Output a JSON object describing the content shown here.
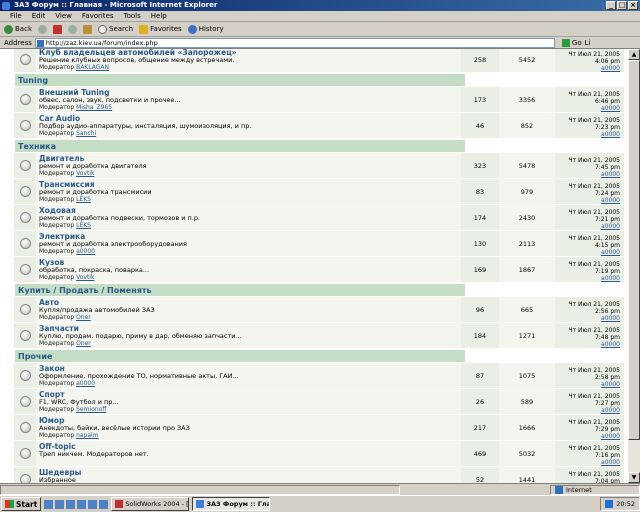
{
  "window": {
    "title": "ЗАЗ Форум :: Главная - Microsoft Internet Explorer"
  },
  "menu": [
    "File",
    "Edit",
    "View",
    "Favorites",
    "Tools",
    "Help"
  ],
  "toolbar": {
    "back": "Back",
    "search": "Search",
    "favorites": "Favorites",
    "history": "History"
  },
  "address": {
    "label": "Address",
    "url": "http://zaz.kiev.ua/forum/index.php",
    "go": "Go",
    "links": "Li"
  },
  "forum": {
    "top_row": {
      "name": "Клуб владельцев автомобилей «Запорожец»",
      "desc": "Решение клубных вопросов, общение между встречами.",
      "mod_label": "Модератор",
      "mod": "BAKLAGAN",
      "topics": "258",
      "posts": "5452",
      "last_date": "Чт Июл 21, 2005 4:06 pm",
      "last_user": "a0000"
    },
    "categories": [
      {
        "title": "Tuning",
        "forums": [
          {
            "name": "Внешний Tuning",
            "desc": "обвес, салон, звук, подсветки и прочее...",
            "mod_label": "Модератор",
            "mod": "Misha_Z965",
            "topics": "173",
            "posts": "3356",
            "last_date": "Чт Июл 21, 2005 6:46 pm",
            "last_user": "a0000"
          },
          {
            "name": "Car Audio",
            "desc": "Подбор аудио-аппаратуры, инсталяция, шумоизоляция, и пр.",
            "mod_label": "Модератор",
            "mod": "Sanchi",
            "topics": "46",
            "posts": "852",
            "last_date": "Чт Июл 21, 2005 7:23 pm",
            "last_user": "a0000"
          }
        ]
      },
      {
        "title": "Техника",
        "forums": [
          {
            "name": "Двигатель",
            "desc": "ремонт и доработка двигателя",
            "mod_label": "Модератор",
            "mod": "Vovtik",
            "topics": "323",
            "posts": "5478",
            "last_date": "Чт Июл 21, 2005 7:45 pm",
            "last_user": "a0000"
          },
          {
            "name": "Трансмиссия",
            "desc": "ремонт и доработка трансмисии",
            "mod_label": "Модератор",
            "mod": "LEKS",
            "topics": "83",
            "posts": "979",
            "last_date": "Чт Июл 21, 2005 7:24 pm",
            "last_user": "a0000"
          },
          {
            "name": "Ходовая",
            "desc": "ремонт и доработка подвески, тормозов и п.р.",
            "mod_label": "Модератор",
            "mod": "LEKS",
            "topics": "174",
            "posts": "2430",
            "last_date": "Чт Июл 21, 2005 7:21 pm",
            "last_user": "a0000"
          },
          {
            "name": "Электрика",
            "desc": "ремонт и доработка электрооборудования",
            "mod_label": "Модератор",
            "mod": "a0000",
            "topics": "130",
            "posts": "2113",
            "last_date": "Чт Июл 21, 2005 4:15 pm",
            "last_user": "a0000"
          },
          {
            "name": "Кузов",
            "desc": "обработка, покраска, поварка...",
            "mod_label": "Модератор",
            "mod": "Vovtik",
            "topics": "169",
            "posts": "1867",
            "last_date": "Чт Июл 21, 2005 7:19 pm",
            "last_user": "a0000"
          }
        ]
      },
      {
        "title": "Купить / Продать / Поменять",
        "forums": [
          {
            "name": "Авто",
            "desc": "Купля/продажа автомобилей ЗАЗ",
            "mod_label": "Модератор",
            "mod": "Oner",
            "topics": "96",
            "posts": "665",
            "last_date": "Чт Июл 21, 2005 2:56 pm",
            "last_user": "a0000"
          },
          {
            "name": "Запчасти",
            "desc": "Куплю, продам, подарю, приму в дар, обменяю запчасти...",
            "mod_label": "Модератор",
            "mod": "Oner",
            "topics": "184",
            "posts": "1271",
            "last_date": "Чт Июл 21, 2005 7:48 pm",
            "last_user": "a0000"
          }
        ]
      },
      {
        "title": "Прочие",
        "forums": [
          {
            "name": "Закон",
            "desc": "Оформление, прохождение ТО, нормативные акты, ГАИ...",
            "mod_label": "Модератор",
            "mod": "a0000",
            "topics": "87",
            "posts": "1075",
            "last_date": "Чт Июл 21, 2005 2:58 pm",
            "last_user": "a0000"
          },
          {
            "name": "Спорт",
            "desc": "F1, WRC, Футбол и пр...",
            "mod_label": "Модератор",
            "mod": "Semionoff",
            "topics": "26",
            "posts": "589",
            "last_date": "Чт Июл 21, 2005 7:27 pm",
            "last_user": "a0000"
          },
          {
            "name": "Юмор",
            "desc": "Анекдоты, байки, весёлые истории про ЗАЗ",
            "mod_label": "Модератор",
            "mod": "napalm",
            "topics": "217",
            "posts": "1666",
            "last_date": "Чт Июл 21, 2005 7:29 pm",
            "last_user": "a0000"
          },
          {
            "name": "Off-topic",
            "desc": "Треп никчем. Модераторов нет.",
            "mod_label": "",
            "mod": "",
            "topics": "469",
            "posts": "5032",
            "last_date": "Чт Июл 21, 2005 7:16 pm",
            "last_user": "a0000"
          },
          {
            "name": "Шедевры",
            "desc": "Избранное",
            "mod_label": "",
            "mod": "",
            "topics": "52",
            "posts": "1441",
            "last_date": "Чт Июл 21, 2005 7:04 pm",
            "last_user": "a0000"
          }
        ]
      }
    ]
  },
  "status": {
    "zone": "Internet"
  },
  "taskbar": {
    "start": "Start",
    "tasks": [
      "SolidWorks 2004 - [Сбор...",
      "ЗАЗ Форум :: Главная ..."
    ],
    "clock": "20:52"
  }
}
